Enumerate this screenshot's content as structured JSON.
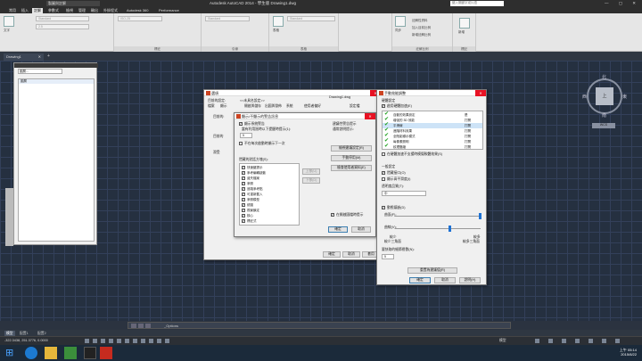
{
  "titlebar": {
    "workspace": "製圖與註解",
    "title": "Autodesk AutoCAD 2014 - 學生版    Drawing1.dwg",
    "search_placeholder": "鍵入關鍵字或片語",
    "window_buttons": "— ▢ ✕"
  },
  "ribbon_tabs": [
    "常用",
    "插入",
    "註解",
    "參數式",
    "檢視",
    "管理",
    "輸出",
    "外掛程式",
    "Autodesk 360",
    "Performance"
  ],
  "active_ribbon_tab": "註解",
  "ribbon": {
    "text_style": "Standard",
    "text_height": "2.5",
    "dim_style": "ISO-25",
    "leader_style": "Standard",
    "table_style": "Standard",
    "panels": [
      "文字",
      "標註",
      "引線",
      "表格",
      "標記",
      "註解比例",
      "雜記"
    ],
    "panel_labels": [
      "標註",
      "引線",
      "表格",
      "註解比例",
      "標記"
    ],
    "annotation_items": [
      "註解性資料",
      "加入目前比例",
      "新增註解比例"
    ],
    "sync_label": "同步",
    "big_button_label": "文字",
    "table_label": "表格",
    "add_label": "新增"
  },
  "file_tab": "Drawing1",
  "file_tab_close": "✕",
  "add_tab_icon": "+",
  "palette": {
    "combo": "圖層...",
    "list_header": "圖層"
  },
  "viewcube": {
    "top": "上",
    "north": "北",
    "south": "南",
    "west": "西",
    "east": "東",
    "wcs": "WCS"
  },
  "options_dialog": {
    "title": "選項",
    "current_profile_label": "目前的設定:",
    "current_profile": "<<未具名設定>>",
    "current_drawing_label": "目前的圖檔:",
    "current_drawing": "Drawing1.dwg",
    "tabs": [
      "檔案",
      "顯示",
      "開啟與儲存",
      "出圖與發佈",
      "系統",
      "使用者偏好",
      "製圖",
      "3D 塑型",
      "選取",
      "設定檔"
    ],
    "left_labels": [
      "目前的:",
      "目前的",
      "滑受"
    ],
    "buttons": {
      "ok": "確定",
      "cancel": "取消",
      "apply": "套用",
      "help": "說明"
    }
  },
  "sub_dialog": {
    "title": "顯示/不顯示的警告訊息",
    "heading": "顯示所有警告",
    "checkbox1": "顯示系統警告",
    "checkbox1_desc": "當有利用過時以下提醒時提示(1):",
    "spinner_value": "5",
    "checkbox2": "不在每次啟動時顯示下一次",
    "list_label": "隱藏的對話方塊(S):",
    "items": [
      "快速鍵提示",
      "參考編輯啟動",
      "遺失檔案",
      "參照",
      "追蹤參考點",
      "可重新載入",
      "參照模型",
      "繪圖",
      "視景鎖定",
      "核心",
      "標註式"
    ],
    "side_buttons": [
      "上移(U)",
      "下移(D)"
    ],
    "right_heading": "建議性警告提示",
    "right_desc": "通常說明提示:",
    "right_buttons": [
      "檢視建議設定(R)",
      "手動停用(M)",
      "檢查使用者資料(E)"
    ],
    "bottom_checkbox": "在開啟圖檔時提示",
    "ok": "確定",
    "cancel": "取消"
  },
  "perf_dialog": {
    "title": "手動效能調整",
    "section1": "硬體設定",
    "enable_label": "啟用硬體加速(E)",
    "features": [
      {
        "name": "自動的效果設定",
        "status": "是"
      },
      {
        "name": "增強的 3D 效能",
        "status": "打開"
      },
      {
        "name": "平滑線",
        "status": "打開"
      },
      {
        "name": "進階材料效果",
        "status": "打開"
      },
      {
        "name": "全陰影顯示模式",
        "status": "打開"
      },
      {
        "name": "每像素照明",
        "status": "打開"
      },
      {
        "name": "紋理壓縮",
        "status": "打開"
      }
    ],
    "emulate_label": "在硬體加速不支援時模擬軟體效果(S)",
    "general_heading": "一般設定",
    "general_checks": [
      "隱藏接口(O)",
      "顯示高平滑度(I)"
    ],
    "transparency_label": "透明度品質(T):",
    "transparency_value": "中",
    "dynamic_label": "動態鑲嵌(D)",
    "surface_label": "曲面(F):",
    "curve_label": "曲線(V):",
    "fewer_label": "較少",
    "more_label": "較多",
    "slider_left": "較少三角面",
    "slider_right": "較多三角面",
    "cached_label": "要快取的細節層數(N):",
    "cached_value": "5",
    "reset_button": "重置為建議值(R)",
    "ok": "確定",
    "cancel": "取消",
    "help": "說明(H)"
  },
  "command_line": {
    "text": "_Options"
  },
  "layout_tabs": [
    "模型",
    "配置1",
    "配置2"
  ],
  "active_layout_tab": "模型",
  "coords": "-322.3438, 251.3776, 0.0000",
  "model_label": "模型",
  "clock": {
    "time": "上午 05:14",
    "date": "2015/8/22"
  }
}
